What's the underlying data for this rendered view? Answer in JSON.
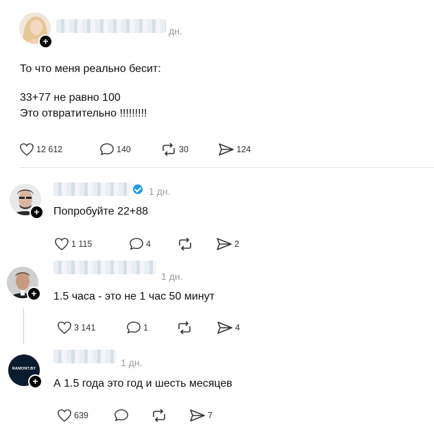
{
  "post": {
    "time": "дн.",
    "text_line1": "То что меня реально бесит:",
    "text_line2": "33+77 не равно 100",
    "text_line3": "Это отвратительно !!!!!!!!!",
    "likes": "12 612",
    "comments": "140",
    "reposts": "30",
    "shares": "124"
  },
  "replies": [
    {
      "time": "1 дн.",
      "text": "Попробуйте 22+88",
      "likes": "1 115",
      "comments": "4",
      "reposts": "",
      "shares": "2",
      "verified": true
    },
    {
      "time": "1 дн.",
      "text": "1.5 часа - это не 1 час 50 минут",
      "likes": "3 141",
      "comments": "1",
      "reposts": "",
      "shares": "4"
    },
    {
      "time": "1 дн.",
      "text": "А 1.5 года это год и шесть месяцев",
      "likes": "639",
      "comments": "",
      "reposts": "",
      "shares": "7",
      "avatar_text": "RAMONT.BY"
    }
  ],
  "icons": [
    "plus-icon",
    "heart-icon",
    "comment-icon",
    "repost-icon",
    "share-icon",
    "verified-icon"
  ]
}
